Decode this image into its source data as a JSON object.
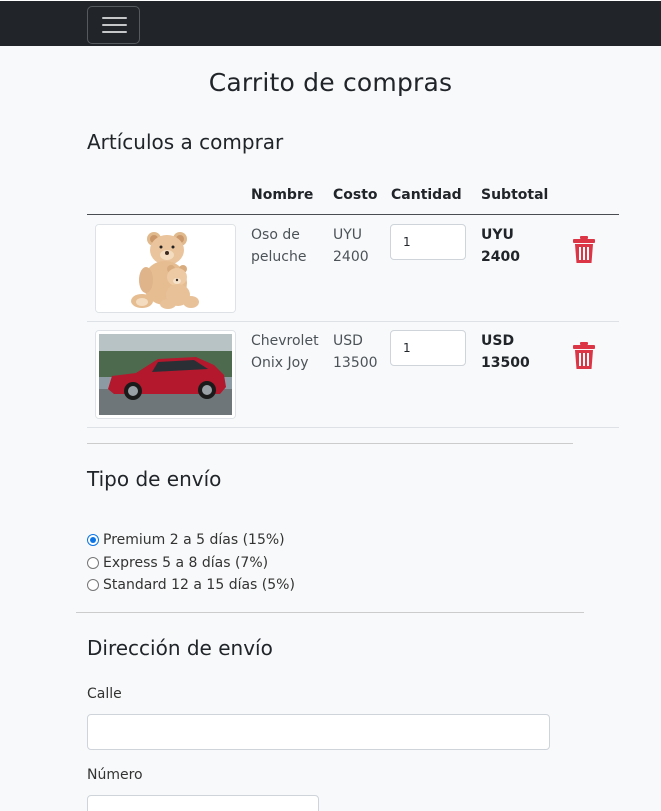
{
  "page_title": "Carrito de compras",
  "cart": {
    "heading": "Artículos a comprar",
    "columns": [
      "",
      "Nombre",
      "Costo",
      "Cantidad",
      "Subtotal"
    ],
    "items": [
      {
        "name_line1": "Oso de",
        "name_line2": "peluche",
        "currency": "UYU",
        "cost": "2400",
        "quantity": "1",
        "subtotal_currency": "UYU",
        "subtotal": "2400",
        "image": "teddy-bear-image"
      },
      {
        "name_line1": "Chevrolet",
        "name_line2": "Onix Joy",
        "currency": "USD",
        "cost": "13500",
        "quantity": "1",
        "subtotal_currency": "USD",
        "subtotal": "13500",
        "image": "red-car-image"
      }
    ]
  },
  "shipping": {
    "heading": "Tipo de envío",
    "options": [
      {
        "label": "Premium 2 a 5 días (15%)",
        "selected": true
      },
      {
        "label": "Express 5 a 8 días (7%)",
        "selected": false
      },
      {
        "label": "Standard 12 a 15 días (5%)",
        "selected": false
      }
    ]
  },
  "address": {
    "heading": "Dirección de envío",
    "street_label": "Calle",
    "street_value": "",
    "number_label": "Número",
    "number_value": ""
  },
  "colors": {
    "navbar": "#212529",
    "accent": "#0b75e6",
    "danger": "#dc3545"
  },
  "icons": {
    "menu": "hamburger-icon",
    "delete": "trash-icon"
  }
}
